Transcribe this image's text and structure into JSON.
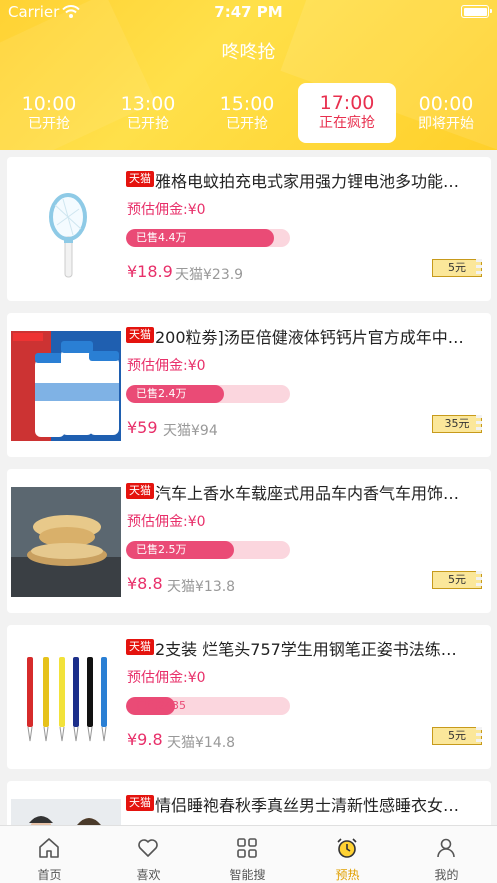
{
  "status_bar": {
    "carrier": "Carrier",
    "time": "7:47 PM"
  },
  "header": {
    "title": "咚咚抢"
  },
  "time_tabs": [
    {
      "time": "10:00",
      "status": "已开抢",
      "active": false
    },
    {
      "time": "13:00",
      "status": "已开抢",
      "active": false
    },
    {
      "time": "15:00",
      "status": "已开抢",
      "active": false
    },
    {
      "time": "17:00",
      "status": "正在疯抢",
      "active": true
    },
    {
      "time": "00:00",
      "status": "即将开始",
      "active": false
    }
  ],
  "products": [
    {
      "badge": "天猫",
      "title": "雅格电蚊拍充电式家用强力锂电池多功能…",
      "commission": "预估佣金:¥0",
      "sold": "已售4.4万",
      "sold_fraction": 0.9,
      "price": "¥18.9",
      "original": "天猫¥23.9",
      "coupon": "5元"
    },
    {
      "badge": "天猫",
      "title": "200粒劵]汤臣倍健液体钙钙片官方成年中…",
      "commission": "预估佣金:¥0",
      "sold": "已售2.4万",
      "sold_fraction": 0.6,
      "price": "¥59",
      "original": "天猫¥94",
      "coupon": "35元"
    },
    {
      "badge": "天猫",
      "title": "汽车上香水车载座式用品车内香气车用饰…",
      "commission": "预估佣金:¥0",
      "sold": "已售2.5万",
      "sold_fraction": 0.66,
      "price": "¥8.8",
      "original": "天猫¥13.8",
      "coupon": "5元"
    },
    {
      "badge": "天猫",
      "title": "2支装 烂笔头757学生用钢笔正姿书法练…",
      "commission": "预估佣金:¥0",
      "sold": "已售2435",
      "sold_fraction": 0.3,
      "price": "¥9.8",
      "original": "天猫¥14.8",
      "coupon": "5元"
    },
    {
      "badge": "天猫",
      "title": "情侣睡袍春秋季真丝男士清新性感睡衣女…"
    }
  ],
  "tab_bar": [
    {
      "label": "首页",
      "icon": "home-icon"
    },
    {
      "label": "喜欢",
      "icon": "heart-icon"
    },
    {
      "label": "智能搜",
      "icon": "grid-icon"
    },
    {
      "label": "预热",
      "icon": "alarm-clock-icon",
      "active": true
    },
    {
      "label": "我的",
      "icon": "person-icon"
    }
  ],
  "colors": {
    "header": "#ffd233",
    "accent": "#e8306a",
    "tmall": "#e4130e",
    "tab_active": "#e0a000"
  }
}
